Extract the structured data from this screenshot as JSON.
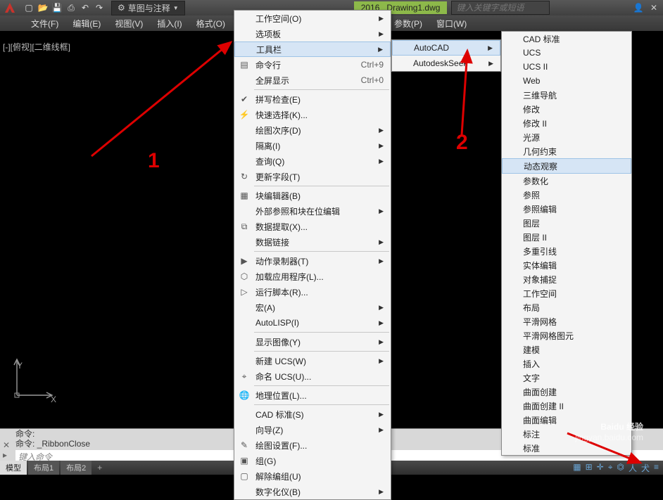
{
  "titlebar": {
    "workspace_label": "草图与注释",
    "year": "2016",
    "doc": "Drawing1.dwg",
    "search_placeholder": "键入关键字或短语"
  },
  "menubar": {
    "file": "文件(F)",
    "edit": "编辑(E)",
    "view": "视图(V)",
    "insert": "插入(I)",
    "format": "格式(O)",
    "param": "参数(P)",
    "window": "窗口(W)"
  },
  "viewport": {
    "label": "[-][俯视][二维线框]",
    "ucs_y": "Y",
    "ucs_x": "X"
  },
  "tools_menu": {
    "workspace": "工作空间(O)",
    "palettes": "选项板",
    "toolbars": "工具栏",
    "commandline": "命令行",
    "commandline_sc": "Ctrl+9",
    "fullscreen": "全屏显示",
    "fullscreen_sc": "Ctrl+0",
    "spell": "拼写检查(E)",
    "quicksel": "快速选择(K)...",
    "draworder": "绘图次序(D)",
    "isolate": "隔离(I)",
    "inquiry": "查询(Q)",
    "updatefields": "更新字段(T)",
    "blockedit": "块编辑器(B)",
    "xrefblock": "外部参照和块在位编辑",
    "dataextract": "数据提取(X)...",
    "datalinks": "数据链接",
    "actionrec": "动作录制器(T)",
    "loadapp": "加载应用程序(L)...",
    "runscript": "运行脚本(R)...",
    "macro": "宏(A)",
    "autolisp": "AutoLISP(I)",
    "dispimage": "显示图像(Y)",
    "newucs": "新建 UCS(W)",
    "namedUcs": "命名 UCS(U)...",
    "geoloc": "地理位置(L)...",
    "cadstd": "CAD 标准(S)",
    "wizards": "向导(Z)",
    "draftsettings": "绘图设置(F)...",
    "group": "组(G)",
    "ungroup": "解除编组(U)",
    "tablet": "数字化仪(B)"
  },
  "submenu1": {
    "autocad": "AutoCAD",
    "autodeskseek": "AutodeskSeek"
  },
  "submenu2": {
    "items": [
      "CAD 标准",
      "UCS",
      "UCS II",
      "Web",
      "三维导航",
      "修改",
      "修改 II",
      "光源",
      "几何约束",
      "动态观察",
      "参数化",
      "参照",
      "参照编辑",
      "图层",
      "图层 II",
      "多重引线",
      "实体编辑",
      "对象捕捉",
      "工作空间",
      "布局",
      "平滑网格",
      "平滑网格图元",
      "建模",
      "插入",
      "文字",
      "曲面创建",
      "曲面创建 II",
      "曲面编辑",
      "标注",
      "标准"
    ],
    "highlight_index": 9
  },
  "annotations": {
    "one": "1",
    "two": "2"
  },
  "cmdline": {
    "hist1": "命令:",
    "hist2": "命令:  _RibbonClose",
    "prompt": "键入命令"
  },
  "statusbar": {
    "tab_model": "模型",
    "tab_layout1": "布局1",
    "tab_layout2": "布局2",
    "plus": "+"
  },
  "watermark": {
    "main": "Baidu 经验",
    "sub": "jingyan.baidu.com"
  }
}
